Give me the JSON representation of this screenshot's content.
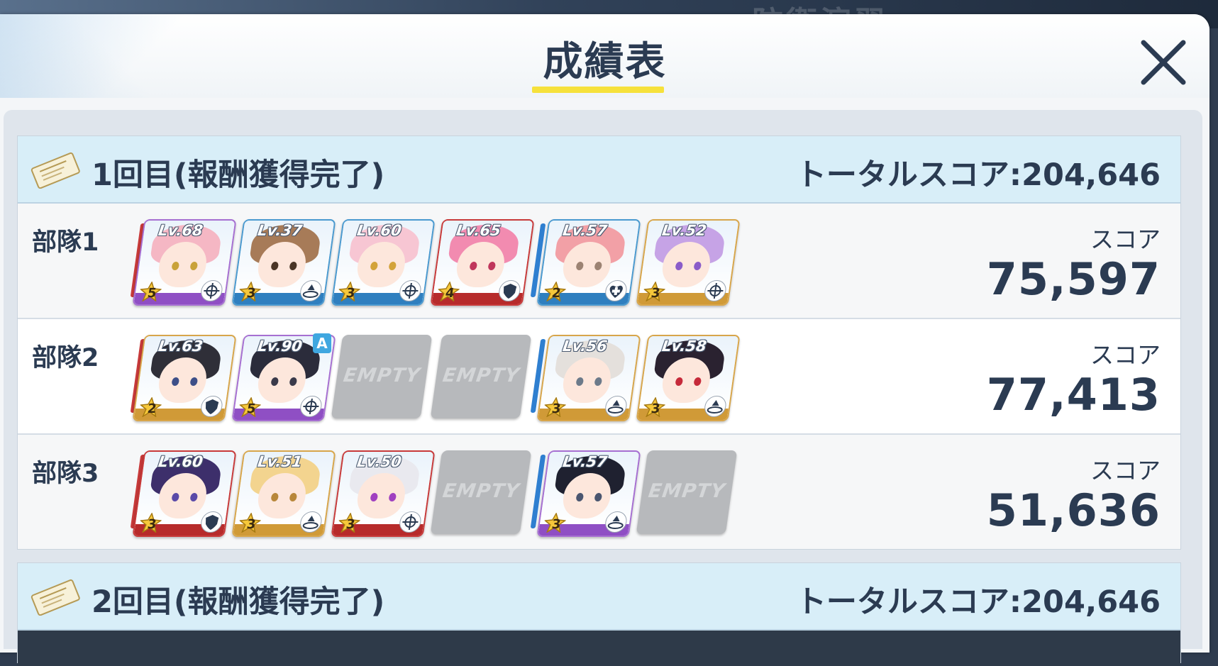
{
  "modal": {
    "title": "成績表",
    "close_icon": "close-icon"
  },
  "background_text": "防衛演習",
  "rounds": [
    {
      "title": "1回目(報酬獲得完了)",
      "total_score": "トータルスコア:204,646",
      "squads": [
        {
          "label": "部隊1",
          "score_label": "スコア",
          "score": "75,597",
          "slots": [
            {
              "type": "char",
              "level": "Lv.68",
              "stars": "5",
              "role": "crosshair-icon",
              "hair": "#f5b7c4",
              "eye": "#c9a23a",
              "frame": "#a66fd2",
              "strip": "#8f4fc4"
            },
            {
              "type": "char",
              "level": "Lv.37",
              "stars": "3",
              "role": "support-icon",
              "hair": "#a77b58",
              "eye": "#4a3526",
              "frame": "#4a9ad0",
              "strip": "#2f7fbf"
            },
            {
              "type": "char",
              "level": "Lv.60",
              "stars": "3",
              "role": "crosshair-icon",
              "hair": "#f7c6d3",
              "eye": "#d3a33a",
              "frame": "#4a9ad0",
              "strip": "#2f7fbf"
            },
            {
              "type": "char",
              "level": "Lv.65",
              "stars": "4",
              "role": "shield-icon",
              "hair": "#f28bb0",
              "eye": "#c0365c",
              "frame": "#c83a3a",
              "strip": "#b72b2b"
            },
            {
              "type": "char",
              "level": "Lv.57",
              "stars": "2",
              "role": "heal-icon",
              "hair": "#f2a0a6",
              "eye": "#9c8373",
              "frame": "#4a9ad0",
              "strip": "#2f7fbf"
            },
            {
              "type": "char",
              "level": "Lv.52",
              "stars": "3",
              "role": "crosshair-icon",
              "hair": "#c6a3e6",
              "eye": "#8a5cc9",
              "frame": "#d8a64b",
              "strip": "#d09a37"
            }
          ]
        },
        {
          "label": "部隊2",
          "score_label": "スコア",
          "score": "77,413",
          "slots": [
            {
              "type": "char",
              "level": "Lv.63",
              "stars": "2",
              "role": "shield-icon",
              "hair": "#2f2f38",
              "eye": "#3d4f88",
              "frame": "#d8a64b",
              "strip": "#d09a37"
            },
            {
              "type": "char",
              "level": "Lv.90",
              "stars": "5",
              "role": "crosshair-icon",
              "hair": "#2b2c3b",
              "eye": "#3a3a4a",
              "frame": "#a66fd2",
              "strip": "#8f4fc4",
              "badge": "A"
            },
            {
              "type": "empty",
              "text": "EMPTY"
            },
            {
              "type": "empty",
              "text": "EMPTY"
            },
            {
              "type": "char",
              "level": "Lv.56",
              "stars": "3",
              "role": "support-icon",
              "hair": "#e4e0dc",
              "eye": "#6c7a8a",
              "frame": "#d8a64b",
              "strip": "#d09a37"
            },
            {
              "type": "char",
              "level": "Lv.58",
              "stars": "3",
              "role": "support-icon",
              "hair": "#2a2230",
              "eye": "#c62a3a",
              "frame": "#d8a64b",
              "strip": "#d09a37"
            }
          ]
        },
        {
          "label": "部隊3",
          "score_label": "スコア",
          "score": "51,636",
          "slots": [
            {
              "type": "char",
              "level": "Lv.60",
              "stars": "3",
              "role": "shield-icon",
              "hair": "#3d2f6b",
              "eye": "#5a4aa8",
              "frame": "#c83a3a",
              "strip": "#b72b2b"
            },
            {
              "type": "char",
              "level": "Lv.51",
              "stars": "3",
              "role": "support-icon",
              "hair": "#f3d48f",
              "eye": "#b8873a",
              "frame": "#d8a64b",
              "strip": "#d09a37"
            },
            {
              "type": "char",
              "level": "Lv.50",
              "stars": "3",
              "role": "crosshair-icon",
              "hair": "#e9e9ef",
              "eye": "#a040c0",
              "frame": "#c83a3a",
              "strip": "#b72b2b"
            },
            {
              "type": "empty",
              "text": "EMPTY"
            },
            {
              "type": "char",
              "level": "Lv.57",
              "stars": "3",
              "role": "support-icon",
              "hair": "#1f2130",
              "eye": "#4a5670",
              "frame": "#a66fd2",
              "strip": "#8f4fc4"
            },
            {
              "type": "empty",
              "text": "EMPTY"
            }
          ]
        }
      ]
    },
    {
      "title": "2回目(報酬獲得完了)",
      "total_score": "トータルスコア:204,646",
      "squads": []
    }
  ],
  "colors": {
    "title_underline": "#f6e13b",
    "round_header_bg": "#d8eef8",
    "text": "#2b3b52",
    "striker_bar": "#c83a3a",
    "special_bar": "#2f7fd0"
  }
}
